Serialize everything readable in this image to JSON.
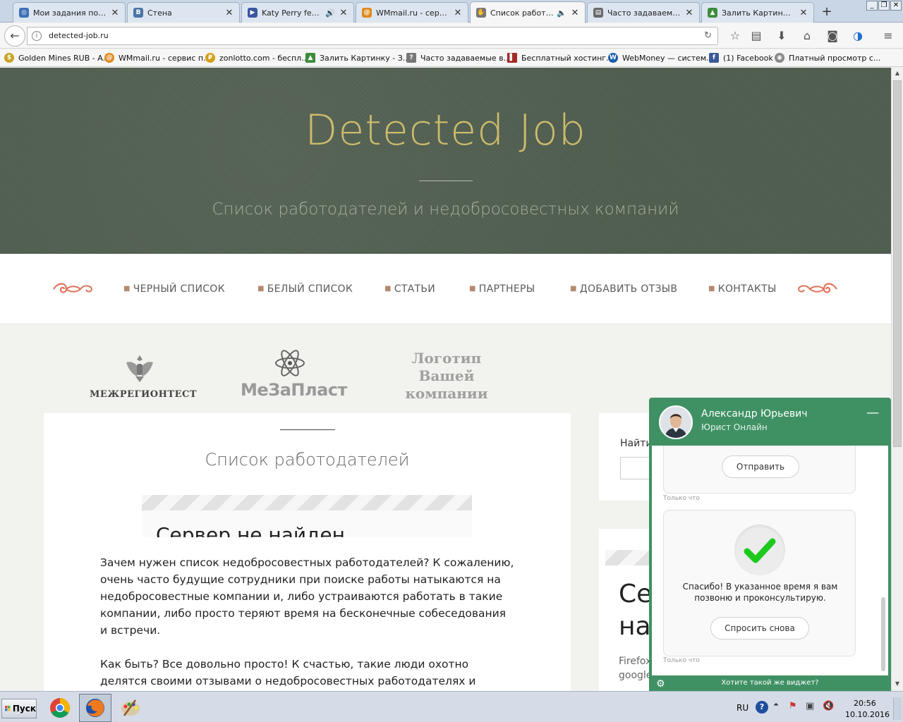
{
  "browser": {
    "tabs": [
      {
        "label": "Мои задания по на...",
        "icon": "swirl-icon",
        "color": "#3b6fb6"
      },
      {
        "label": "Стена",
        "icon": "vk-icon",
        "color": "#4a76a8"
      },
      {
        "label": "Katy Perry feat...",
        "icon": "play-icon",
        "color": "#3a56a0"
      },
      {
        "label": "WMmail.ru - сервис...",
        "icon": "at-icon",
        "color": "#e08a1e"
      },
      {
        "label": "Список работо...",
        "icon": "hand-icon",
        "color": "#555555"
      },
      {
        "label": "Часто задаваемые...",
        "icon": "page-icon",
        "color": "#6a6a6a"
      },
      {
        "label": "Залить Картинку -...",
        "icon": "image-icon",
        "color": "#3c8c3c"
      }
    ],
    "new_tab": "+",
    "url": "detected-job.ru",
    "bookmarks": [
      {
        "label": "Golden Mines RUB - A...",
        "color": "#c9a227",
        "glyph": "$"
      },
      {
        "label": "WMmail.ru - сервис п...",
        "color": "#e08a1e",
        "glyph": "@"
      },
      {
        "label": "zonlotto.com - беспл...",
        "color": "#d4a017",
        "glyph": "₽"
      },
      {
        "label": "Залить Картинку - З...",
        "color": "#3c8c3c",
        "glyph": "▲"
      },
      {
        "label": "Часто задаваемые в...",
        "color": "#777777",
        "glyph": "?"
      },
      {
        "label": "Бесплатный хостинг...",
        "color": "#a52a2a",
        "glyph": "▌"
      },
      {
        "label": "WebMoney — систем...",
        "color": "#1b5faa",
        "glyph": "W"
      },
      {
        "label": "(1) Facebook",
        "color": "#3b5998",
        "glyph": "f"
      },
      {
        "label": "Платный просмотр с...",
        "color": "#888888",
        "glyph": "◉"
      }
    ]
  },
  "site": {
    "title": "Detected Job",
    "tagline": "Список работодателей и недобросовестных компаний",
    "menu": [
      "ЧЕРНЫЙ СПИСОК",
      "БЕЛЫЙ СПИСОК",
      "СТАТЬИ",
      "ПАРТНЕРЫ",
      "ДОБАВИТЬ ОТЗЫВ",
      "КОНТАКТЫ"
    ],
    "logos": {
      "logo1": "МЕЖРЕГИОНТЕСТ",
      "logo2": "МеЗаПласт",
      "logo3": "Логотип Вашей компании"
    },
    "main": {
      "title": "Список работодателей",
      "embed_error": "Сервер не найден",
      "para1": "Зачем нужен список недобросовестных работодателей? К сожалению, очень часто будущие сотрудники при поиске работы натыкаются на недобросовестные компании и, либо устраиваются работать в такие компании, либо просто теряют время на бесконечные собеседования и встречи.",
      "para2": "Как быть? Все довольно просто! К счастью, такие люди охотно делятся своими отзывами о недобросовестных работодателях и предостерегают"
    },
    "sidebar": {
      "search_label": "Найти",
      "embed_big_line1": "Се",
      "embed_big_line2": "на",
      "embed_small_line1": "Firefox",
      "embed_small_line2": "google"
    }
  },
  "chat": {
    "agent_name": "Александр Юрьевич",
    "agent_role": "Юрист Онлайн",
    "send_button": "Отправить",
    "time1": "Только что",
    "thanks": "Спасибо! В указанное время я вам позвоню и проконсультирую.",
    "ask_again": "Спросить снова",
    "time2": "Только что",
    "promo": "Хотите такой же виджет?"
  },
  "taskbar": {
    "start": "Пуск",
    "lang": "RU",
    "time": "20:56",
    "date": "10.10.2016"
  },
  "colors": {
    "hero_bg": "#505e4f",
    "title_gold": "#cdbb6d",
    "chat_green": "#3f9164",
    "ornament": "#e0735a"
  }
}
